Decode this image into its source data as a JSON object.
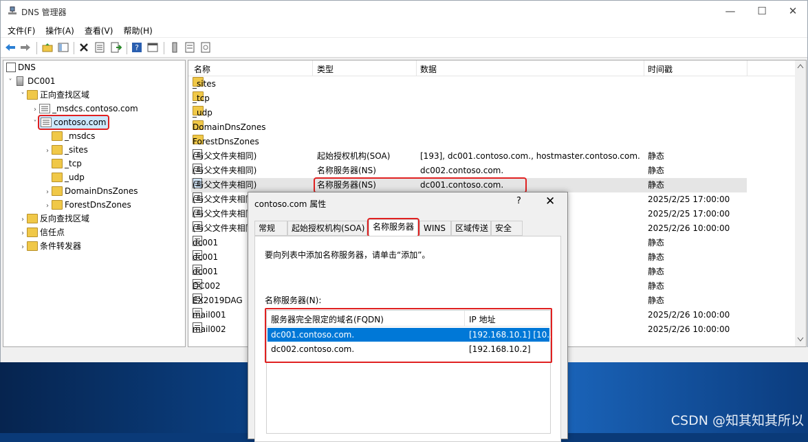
{
  "window": {
    "title": "DNS 管理器",
    "minimize": "—",
    "maximize": "☐",
    "close": "✕"
  },
  "menu": [
    "文件(F)",
    "操作(A)",
    "查看(V)",
    "帮助(H)"
  ],
  "tree": {
    "root": "DNS",
    "server": "DC001",
    "forward": "正向查找区域",
    "msdcs_zone": "_msdcs.contoso.com",
    "contoso": "contoso.com",
    "children": [
      "_msdcs",
      "_sites",
      "_tcp",
      "_udp",
      "DomainDnsZones",
      "ForestDnsZones"
    ],
    "reverse": "反向查找区域",
    "trust": "信任点",
    "forwarders": "条件转发器"
  },
  "list": {
    "headers": {
      "name": "名称",
      "type": "类型",
      "data": "数据",
      "timestamp": "时间戳"
    },
    "folders": [
      "_sites",
      "_tcp",
      "_udp",
      "DomainDnsZones",
      "ForestDnsZones"
    ],
    "records": [
      {
        "name": "(与父文件夹相同)",
        "type": "起始授权机构(SOA)",
        "data": "[193], dc001.contoso.com., hostmaster.contoso.com.",
        "ts": "静态"
      },
      {
        "name": "(与父文件夹相同)",
        "type": "名称服务器(NS)",
        "data": "dc002.contoso.com.",
        "ts": "静态"
      },
      {
        "name": "(与父文件夹相同)",
        "type": "名称服务器(NS)",
        "data": "dc001.contoso.com.",
        "ts": "静态"
      },
      {
        "name": "(与父文件夹相同)",
        "type": "",
        "data": "",
        "ts": "2025/2/25 17:00:00"
      },
      {
        "name": "(与父文件夹相同)",
        "type": "",
        "data": "",
        "ts": "2025/2/25 17:00:00"
      },
      {
        "name": "(与父文件夹相同)",
        "type": "",
        "data": "",
        "ts": "2025/2/26 10:00:00"
      },
      {
        "name": "dc001",
        "type": "",
        "data": "",
        "ts": "静态"
      },
      {
        "name": "dc001",
        "type": "",
        "data": "",
        "ts": "静态"
      },
      {
        "name": "dc001",
        "type": "",
        "data": "",
        "ts": "静态"
      },
      {
        "name": "DC002",
        "type": "",
        "data": "",
        "ts": "静态"
      },
      {
        "name": "EX2019DAG",
        "type": "",
        "data": "",
        "ts": "静态"
      },
      {
        "name": "mail001",
        "type": "",
        "data": "",
        "ts": "2025/2/26 10:00:00"
      },
      {
        "name": "mail002",
        "type": "",
        "data": "",
        "ts": "2025/2/26 10:00:00"
      }
    ]
  },
  "dialog": {
    "title": "contoso.com 属性",
    "help": "?",
    "close": "✕",
    "tabs": [
      "常规",
      "起始授权机构(SOA)",
      "名称服务器",
      "WINS",
      "区域传送",
      "安全"
    ],
    "instruction": "要向列表中添加名称服务器，请单击“添加”。",
    "ns_label": "名称服务器(N):",
    "columns": {
      "fqdn": "服务器完全限定的域名(FQDN)",
      "ip": "IP 地址"
    },
    "servers": [
      {
        "fqdn": "dc001.contoso.com.",
        "ip": "[192.168.10.1] [10..."
      },
      {
        "fqdn": "dc002.contoso.com.",
        "ip": "[192.168.10.2]"
      }
    ]
  },
  "watermark": "CSDN @知其知其所以",
  "colors": {
    "selection": "#0078d7",
    "highlight_box": "#e02020",
    "folder": "#f0c848"
  }
}
